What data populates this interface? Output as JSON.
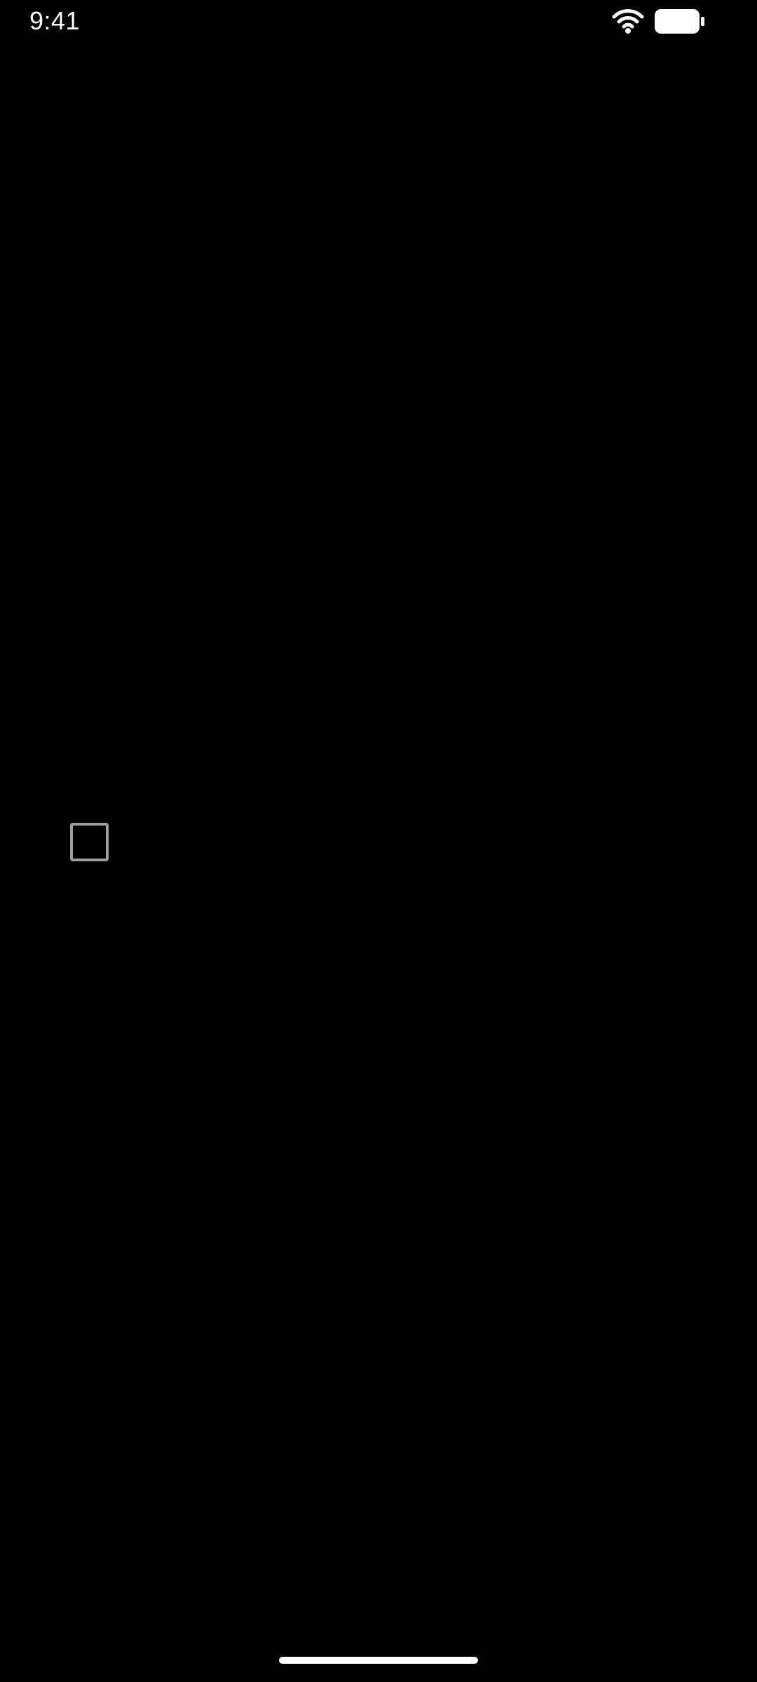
{
  "status_bar": {
    "time": "9:41",
    "wifi_icon": "wifi-icon",
    "battery_icon": "battery-icon",
    "icon_color": "#ffffff"
  },
  "content": {
    "checkbox": {
      "checked": false,
      "border_color": "#9e9e9e"
    }
  },
  "home_indicator": {
    "color": "#ffffff"
  },
  "colors": {
    "background": "#000000",
    "text": "#ffffff"
  }
}
